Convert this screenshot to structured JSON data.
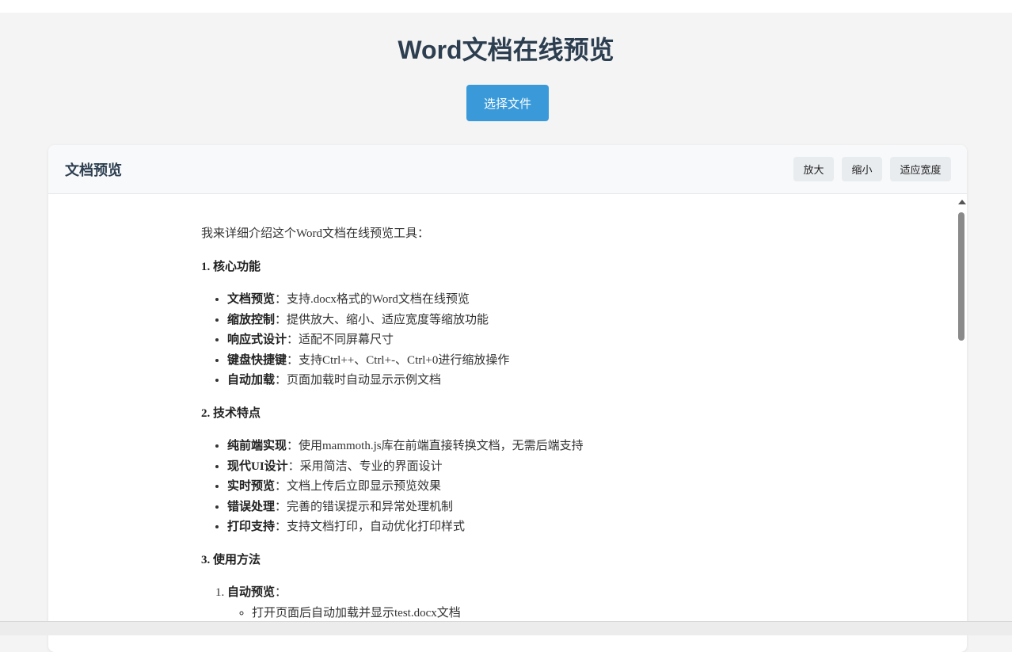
{
  "header": {
    "title": "Word文档在线预览",
    "select_file_label": "选择文件"
  },
  "preview": {
    "title": "文档预览",
    "zoom_in_label": "放大",
    "zoom_out_label": "缩小",
    "fit_width_label": "适应宽度"
  },
  "document": {
    "intro": "我来详细介绍这个Word文档在线预览工具：",
    "sections": [
      {
        "heading": "1. 核心功能",
        "items": [
          {
            "term": "文档预览",
            "desc": "：支持.docx格式的Word文档在线预览"
          },
          {
            "term": "缩放控制",
            "desc": "：提供放大、缩小、适应宽度等缩放功能"
          },
          {
            "term": "响应式设计",
            "desc": "：适配不同屏幕尺寸"
          },
          {
            "term": "键盘快捷键",
            "desc": "：支持Ctrl++、Ctrl+-、Ctrl+0进行缩放操作"
          },
          {
            "term": "自动加载",
            "desc": "：页面加载时自动显示示例文档"
          }
        ]
      },
      {
        "heading": "2. 技术特点",
        "items": [
          {
            "term": "纯前端实现",
            "desc": "：使用mammoth.js库在前端直接转换文档，无需后端支持"
          },
          {
            "term": "现代UI设计",
            "desc": "：采用简洁、专业的界面设计"
          },
          {
            "term": "实时预览",
            "desc": "：文档上传后立即显示预览效果"
          },
          {
            "term": "错误处理",
            "desc": "：完善的错误提示和异常处理机制"
          },
          {
            "term": "打印支持",
            "desc": "：支持文档打印，自动优化打印样式"
          }
        ]
      },
      {
        "heading": "3. 使用方法",
        "ordered": [
          {
            "term": "自动预览",
            "desc": "：",
            "sub": [
              "打开页面后自动加载并显示test.docx文档"
            ]
          }
        ]
      }
    ]
  },
  "colors": {
    "accent": "#3a9ad9",
    "title": "#2c3e50",
    "background": "#f4f4f4"
  }
}
